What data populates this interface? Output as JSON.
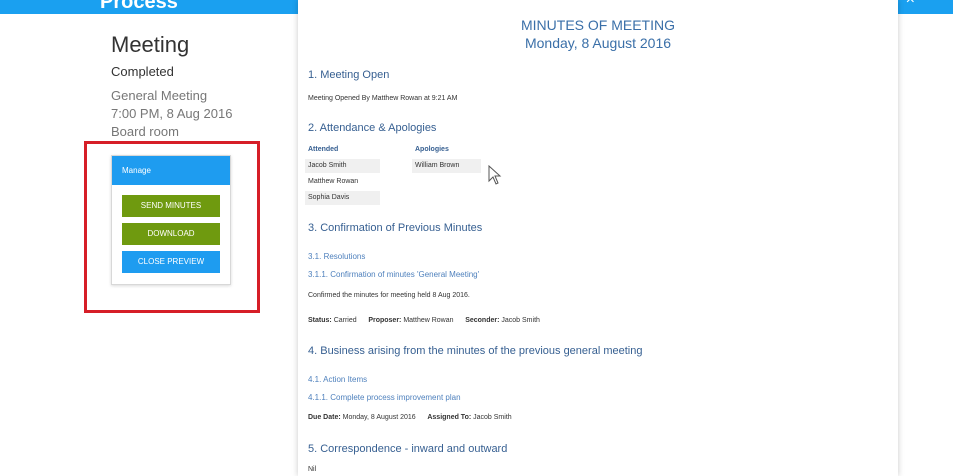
{
  "app": {
    "brand": "Process",
    "close_glyph": "×"
  },
  "meeting": {
    "title": "Meeting",
    "status": "Completed",
    "type": "General Meeting",
    "time": "7:00 PM, 8 Aug 2016",
    "room": "Board room"
  },
  "manage": {
    "header": "Manage",
    "send_minutes": "SEND MINUTES",
    "download": "DOWNLOAD",
    "close_preview": "CLOSE PREVIEW"
  },
  "document": {
    "title": "MINUTES OF MEETING",
    "date": "Monday, 8 August 2016",
    "s1": {
      "heading": "1. Meeting Open",
      "text": "Meeting Opened By Matthew Rowan at 9:21 AM"
    },
    "s2": {
      "heading": "2. Attendance & Apologies",
      "attended_label": "Attended",
      "apologies_label": "Apologies",
      "attended": [
        "Jacob Smith",
        "Matthew Rowan",
        "Sophia Davis"
      ],
      "apologies": [
        "William Brown"
      ]
    },
    "s3": {
      "heading": "3. Confirmation of Previous Minutes",
      "sub": "3.1. Resolutions",
      "subsub": "3.1.1. Confirmation of minutes 'General Meeting'",
      "text": "Confirmed the minutes for meeting held 8 Aug 2016.",
      "status_label": "Status:",
      "status_value": "Carried",
      "proposer_label": "Proposer:",
      "proposer_value": "Matthew Rowan",
      "seconder_label": "Seconder:",
      "seconder_value": "Jacob Smith"
    },
    "s4": {
      "heading": "4. Business arising from the minutes of the previous general meeting",
      "sub": "4.1. Action Items",
      "subsub": "4.1.1. Complete process improvement plan",
      "due_label": "Due Date:",
      "due_value": "Monday, 8 August 2016",
      "assigned_label": "Assigned To:",
      "assigned_value": "Jacob Smith"
    },
    "s5": {
      "heading": "5. Correspondence - inward and outward",
      "text": "Nil"
    }
  },
  "colors": {
    "topbar": "#1aa0f0",
    "manage_header": "#1e9cf0",
    "button_green": "#6f9a0f",
    "button_blue": "#1e9cf0",
    "highlight": "#d61e28",
    "heading": "#365f91"
  },
  "icons": {
    "cursor": "mouse-pointer-icon"
  }
}
